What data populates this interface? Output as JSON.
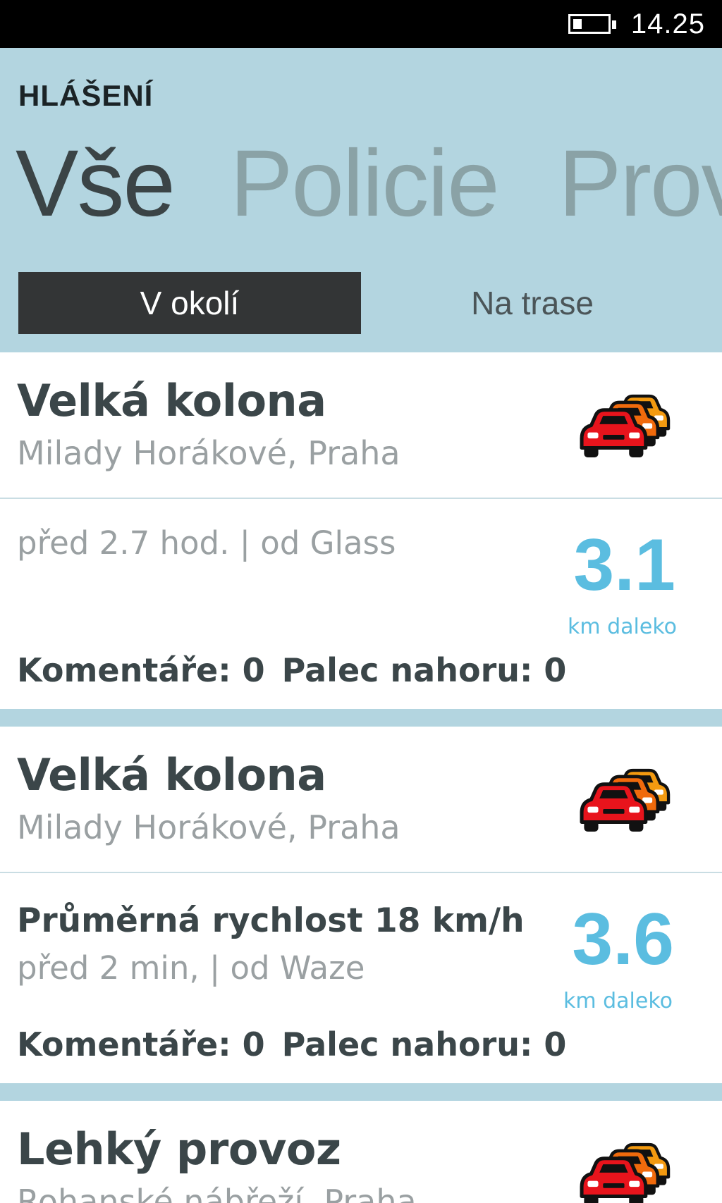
{
  "status_bar": {
    "time": "14.25",
    "battery_level": 0.25
  },
  "header": {
    "title": "HLÁŠENÍ",
    "pivots": [
      {
        "label": "Vše",
        "active": true
      },
      {
        "label": "Policie",
        "active": false
      },
      {
        "label": "Prov",
        "active": false
      }
    ]
  },
  "segments": [
    {
      "label": "V okolí",
      "active": true
    },
    {
      "label": "Na trase",
      "active": false
    }
  ],
  "reports": [
    {
      "title": "Velká kolona",
      "location": "Milady Horákové, Praha",
      "icon": "traffic-jam-icon",
      "subtitle": "",
      "meta": "před 2.7 hod. | od Glass",
      "distance": "3.1",
      "distance_unit": "km daleko",
      "comments_label": "Komentáře: 0",
      "thumbs_label": "Palec nahoru: 0"
    },
    {
      "title": "Velká kolona",
      "location": "Milady Horákové, Praha",
      "icon": "traffic-jam-icon",
      "subtitle": "Průměrná rychlost 18 km/h",
      "meta": "před 2 min, | od Waze",
      "distance": "3.6",
      "distance_unit": "km daleko",
      "comments_label": "Komentáře: 0",
      "thumbs_label": "Palec nahoru: 0"
    },
    {
      "title": "Lehký provoz",
      "location": "Rohanské nábřeží, Praha",
      "icon": "traffic-jam-icon"
    }
  ],
  "colors": {
    "header_bg": "#b3d5e0",
    "accent": "#5bbde0",
    "car_red": "#e8141c",
    "car_orange": "#f06a0c",
    "car_amber": "#f39a10"
  }
}
